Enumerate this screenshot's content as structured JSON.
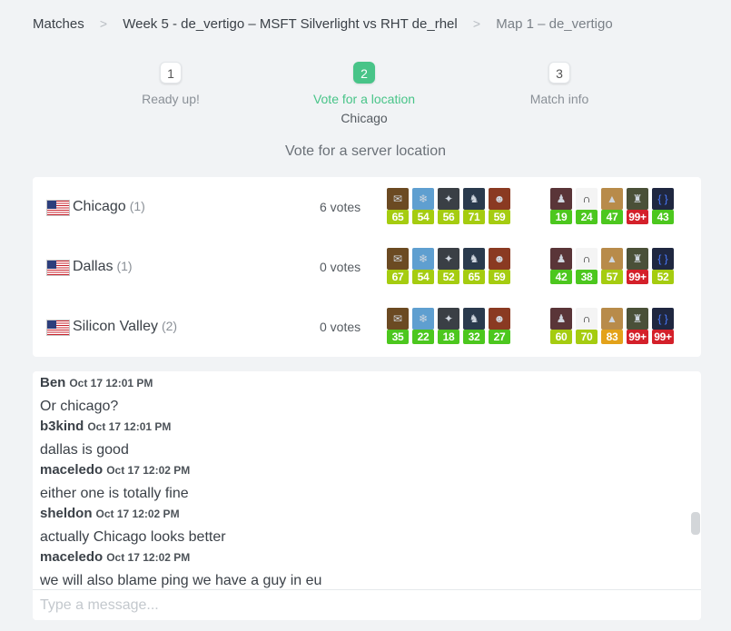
{
  "breadcrumb": {
    "items": [
      "Matches",
      "Week 5 - de_vertigo – MSFT Silverlight vs RHT de_rhel",
      "Map 1 – de_vertigo"
    ],
    "separator": ">"
  },
  "stepper": {
    "steps": [
      {
        "num": "1",
        "label": "Ready up!",
        "sub": ""
      },
      {
        "num": "2",
        "label": "Vote for a location",
        "sub": "Chicago"
      },
      {
        "num": "3",
        "label": "Match info",
        "sub": ""
      }
    ],
    "active_index": 1
  },
  "vote_title": "Vote for a server location",
  "locations": [
    {
      "name": "Chicago",
      "count": "(1)",
      "votes": "6 votes",
      "team_a": [
        "65",
        "54",
        "56",
        "71",
        "59"
      ],
      "team_b": [
        "19",
        "24",
        "47",
        "99+",
        "43"
      ]
    },
    {
      "name": "Dallas",
      "count": "(1)",
      "votes": "0 votes",
      "team_a": [
        "67",
        "54",
        "52",
        "65",
        "59"
      ],
      "team_b": [
        "42",
        "38",
        "57",
        "99+",
        "52"
      ]
    },
    {
      "name": "Silicon Valley",
      "count": "(2)",
      "votes": "0 votes",
      "team_a": [
        "35",
        "22",
        "18",
        "32",
        "27"
      ],
      "team_b": [
        "60",
        "70",
        "83",
        "99+",
        "99+"
      ]
    }
  ],
  "chat": {
    "messages": [
      {
        "author": "Ben",
        "time": "Oct 17 12:01 PM",
        "text": "Or chicago?"
      },
      {
        "author": "b3kind",
        "time": "Oct 17 12:01 PM",
        "text": "dallas is good"
      },
      {
        "author": "maceledo",
        "time": "Oct 17 12:02 PM",
        "text": "either one is totally fine"
      },
      {
        "author": "sheldon",
        "time": "Oct 17 12:02 PM",
        "text": "actually Chicago looks better"
      },
      {
        "author": "maceledo",
        "time": "Oct 17 12:02 PM",
        "text": "we will also blame ping we have a guy in eu"
      }
    ],
    "placeholder": "Type a message..."
  },
  "colors": {
    "accent": "#48c488",
    "ping_good": "#4cc71e",
    "ping_ok": "#a5cc10",
    "ping_warn": "#e3a21a",
    "ping_bad": "#d4202a"
  },
  "icons": [
    "us-flag-icon",
    "player-avatar-icon"
  ]
}
